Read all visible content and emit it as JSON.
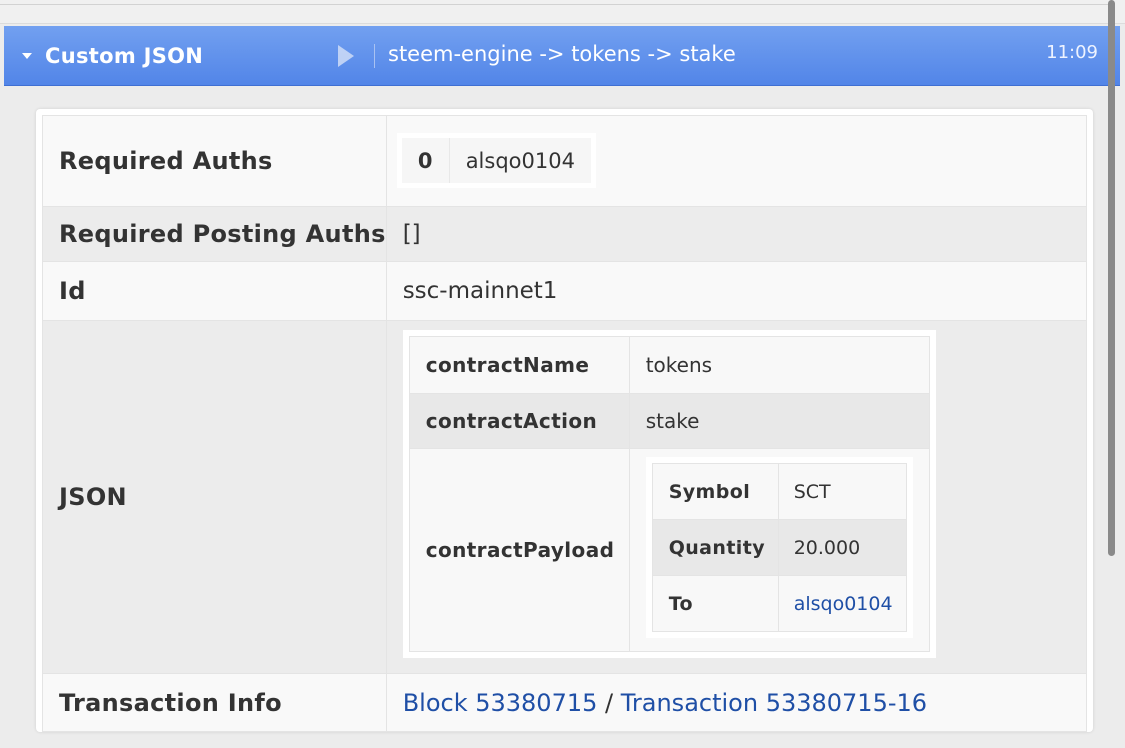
{
  "header": {
    "title": "Custom JSON",
    "path": "steem-engine -> tokens -> stake",
    "time": "11:09"
  },
  "rows": {
    "required_auths": {
      "label": "Required Auths",
      "items": [
        {
          "index": "0",
          "name": "alsqo0104"
        }
      ]
    },
    "required_posting": {
      "label": "Required Posting Auths",
      "value": "[]"
    },
    "id": {
      "label": "Id",
      "value": "ssc-mainnet1"
    },
    "json": {
      "label": "JSON",
      "contract_name": {
        "key": "contractName",
        "value": "tokens"
      },
      "contract_action": {
        "key": "contractAction",
        "value": "stake"
      },
      "contract_payload": {
        "key": "contractPayload",
        "symbol": {
          "key": "Symbol",
          "value": "SCT"
        },
        "quantity": {
          "key": "Quantity",
          "value": "20.000"
        },
        "to": {
          "key": "To",
          "value": "alsqo0104"
        }
      }
    },
    "tx_info": {
      "label": "Transaction Info",
      "block": "Block 53380715",
      "separator": "/",
      "transaction": "Transaction 53380715-16"
    }
  },
  "colors": {
    "header_bg": "#5e8fee",
    "link": "#1f4fa6"
  }
}
